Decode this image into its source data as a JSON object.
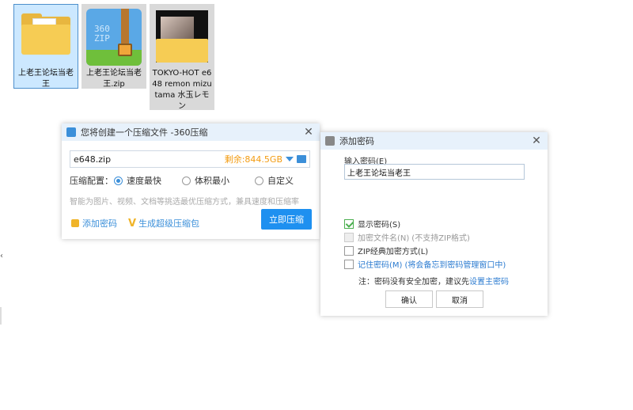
{
  "desktop": {
    "files": [
      {
        "name": "上老王论坛当老王",
        "type": "folder"
      },
      {
        "name": "上老王论坛当老王.zip",
        "type": "zip-archive",
        "icon_text": "360\nZIP"
      },
      {
        "name": "TOKYO-HOT e648 remon mizutama 水玉レモン",
        "type": "image-folder"
      }
    ]
  },
  "compress_dialog": {
    "title": "您将创建一个压缩文件 -360压缩",
    "filename": "e648.zip",
    "free_space": "剩余:844.5GB",
    "config_label": "压缩配置：",
    "options": [
      "速度最快",
      "体积最小",
      "自定义"
    ],
    "selected_option": "速度最快",
    "hint": "智能为图片、视频、文档等挑选最优压缩方式，兼具速度和压缩率",
    "add_password": "添加密码",
    "super_pack": "生成超级压缩包",
    "compress_now": "立即压缩"
  },
  "password_dialog": {
    "title": "添加密码",
    "input_label": "输入密码(E)",
    "password_value": "上老王论坛当老王",
    "show_password": "显示密码(S)",
    "encrypt_filenames": "加密文件名(N)",
    "encrypt_filenames_note": "(不支持ZIP格式)",
    "zip_classic": "ZIP经典加密方式(L)",
    "remember_password": "记住密码(M)",
    "remember_note": "(将会备忘到密码管理窗口中)",
    "note_prefix": "注：密码没有安全加密，建议先",
    "note_link": "设置主密码",
    "ok": "确认",
    "cancel": "取消",
    "show_password_checked": true
  },
  "colors": {
    "accent": "#1e90f0",
    "title_bar": "#e7f1fb",
    "warning": "#f39c12"
  }
}
